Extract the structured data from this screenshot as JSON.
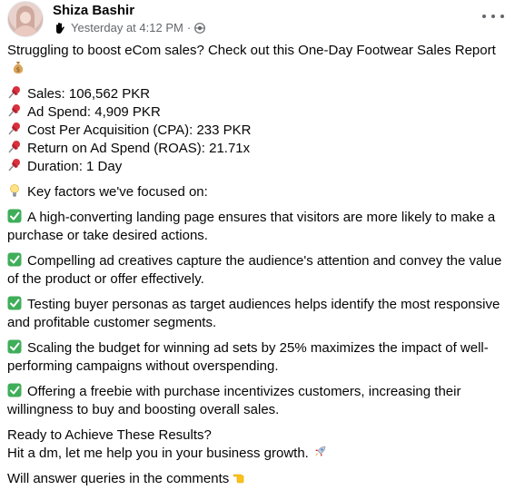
{
  "post": {
    "author": "Shiza Bashir",
    "timestamp": "Yesterday at 4:12 PM",
    "separator": "·",
    "intro": "Struggling to boost eCom sales? Check out this One-Day Footwear Sales Report",
    "stats": [
      {
        "icon": "pushpin-icon",
        "text": "Sales: 106,562 PKR"
      },
      {
        "icon": "pushpin-icon",
        "text": "Ad Spend: 4,909 PKR"
      },
      {
        "icon": "pushpin-icon",
        "text": "Cost Per Acquisition (CPA): 233 PKR"
      },
      {
        "icon": "pushpin-icon",
        "text": "Return on Ad Spend (ROAS): 21.71x"
      },
      {
        "icon": "pushpin-icon",
        "text": "Duration: 1 Day"
      }
    ],
    "key_factors_heading": "Key factors we've focused on:",
    "factors": [
      {
        "line1": "A high-converting landing page ensures that visitors are more likely to make a",
        "line2": "purchase or take desired actions."
      },
      {
        "line1": "Compelling ad creatives capture the audience's attention and convey the value",
        "line2": "of the product or offer effectively."
      },
      {
        "line1": "Testing buyer personas as target audiences helps identify the most responsive",
        "line2": "and profitable customer segments."
      },
      {
        "line1": "Scaling the budget for winning ad sets by 25% maximizes the impact of well-",
        "line2": "performing campaigns without overspending."
      },
      {
        "line1": "Offering a freebie with purchase incentivizes customers, increasing their",
        "line2": "willingness to buy and boosting overall sales."
      }
    ],
    "cta_line1": "Ready to Achieve These Results?",
    "cta_line2": "Hit a dm, let me help you in your business growth.",
    "closing": "Will answer queries in the comments"
  },
  "icons": {
    "intro_emoji": "money-bag-icon",
    "bulb": "light-bulb-icon",
    "check": "check-mark-icon",
    "rocket": "rocket-icon",
    "pointing": "pointing-hand-icon",
    "privacy": "globe-icon",
    "badge": "hand-badge-icon",
    "more": "more-options-icon"
  },
  "colors": {
    "text": "#050505",
    "secondary": "#65676b",
    "check_green": "#3fae5a",
    "pin_red": "#d8313d"
  }
}
